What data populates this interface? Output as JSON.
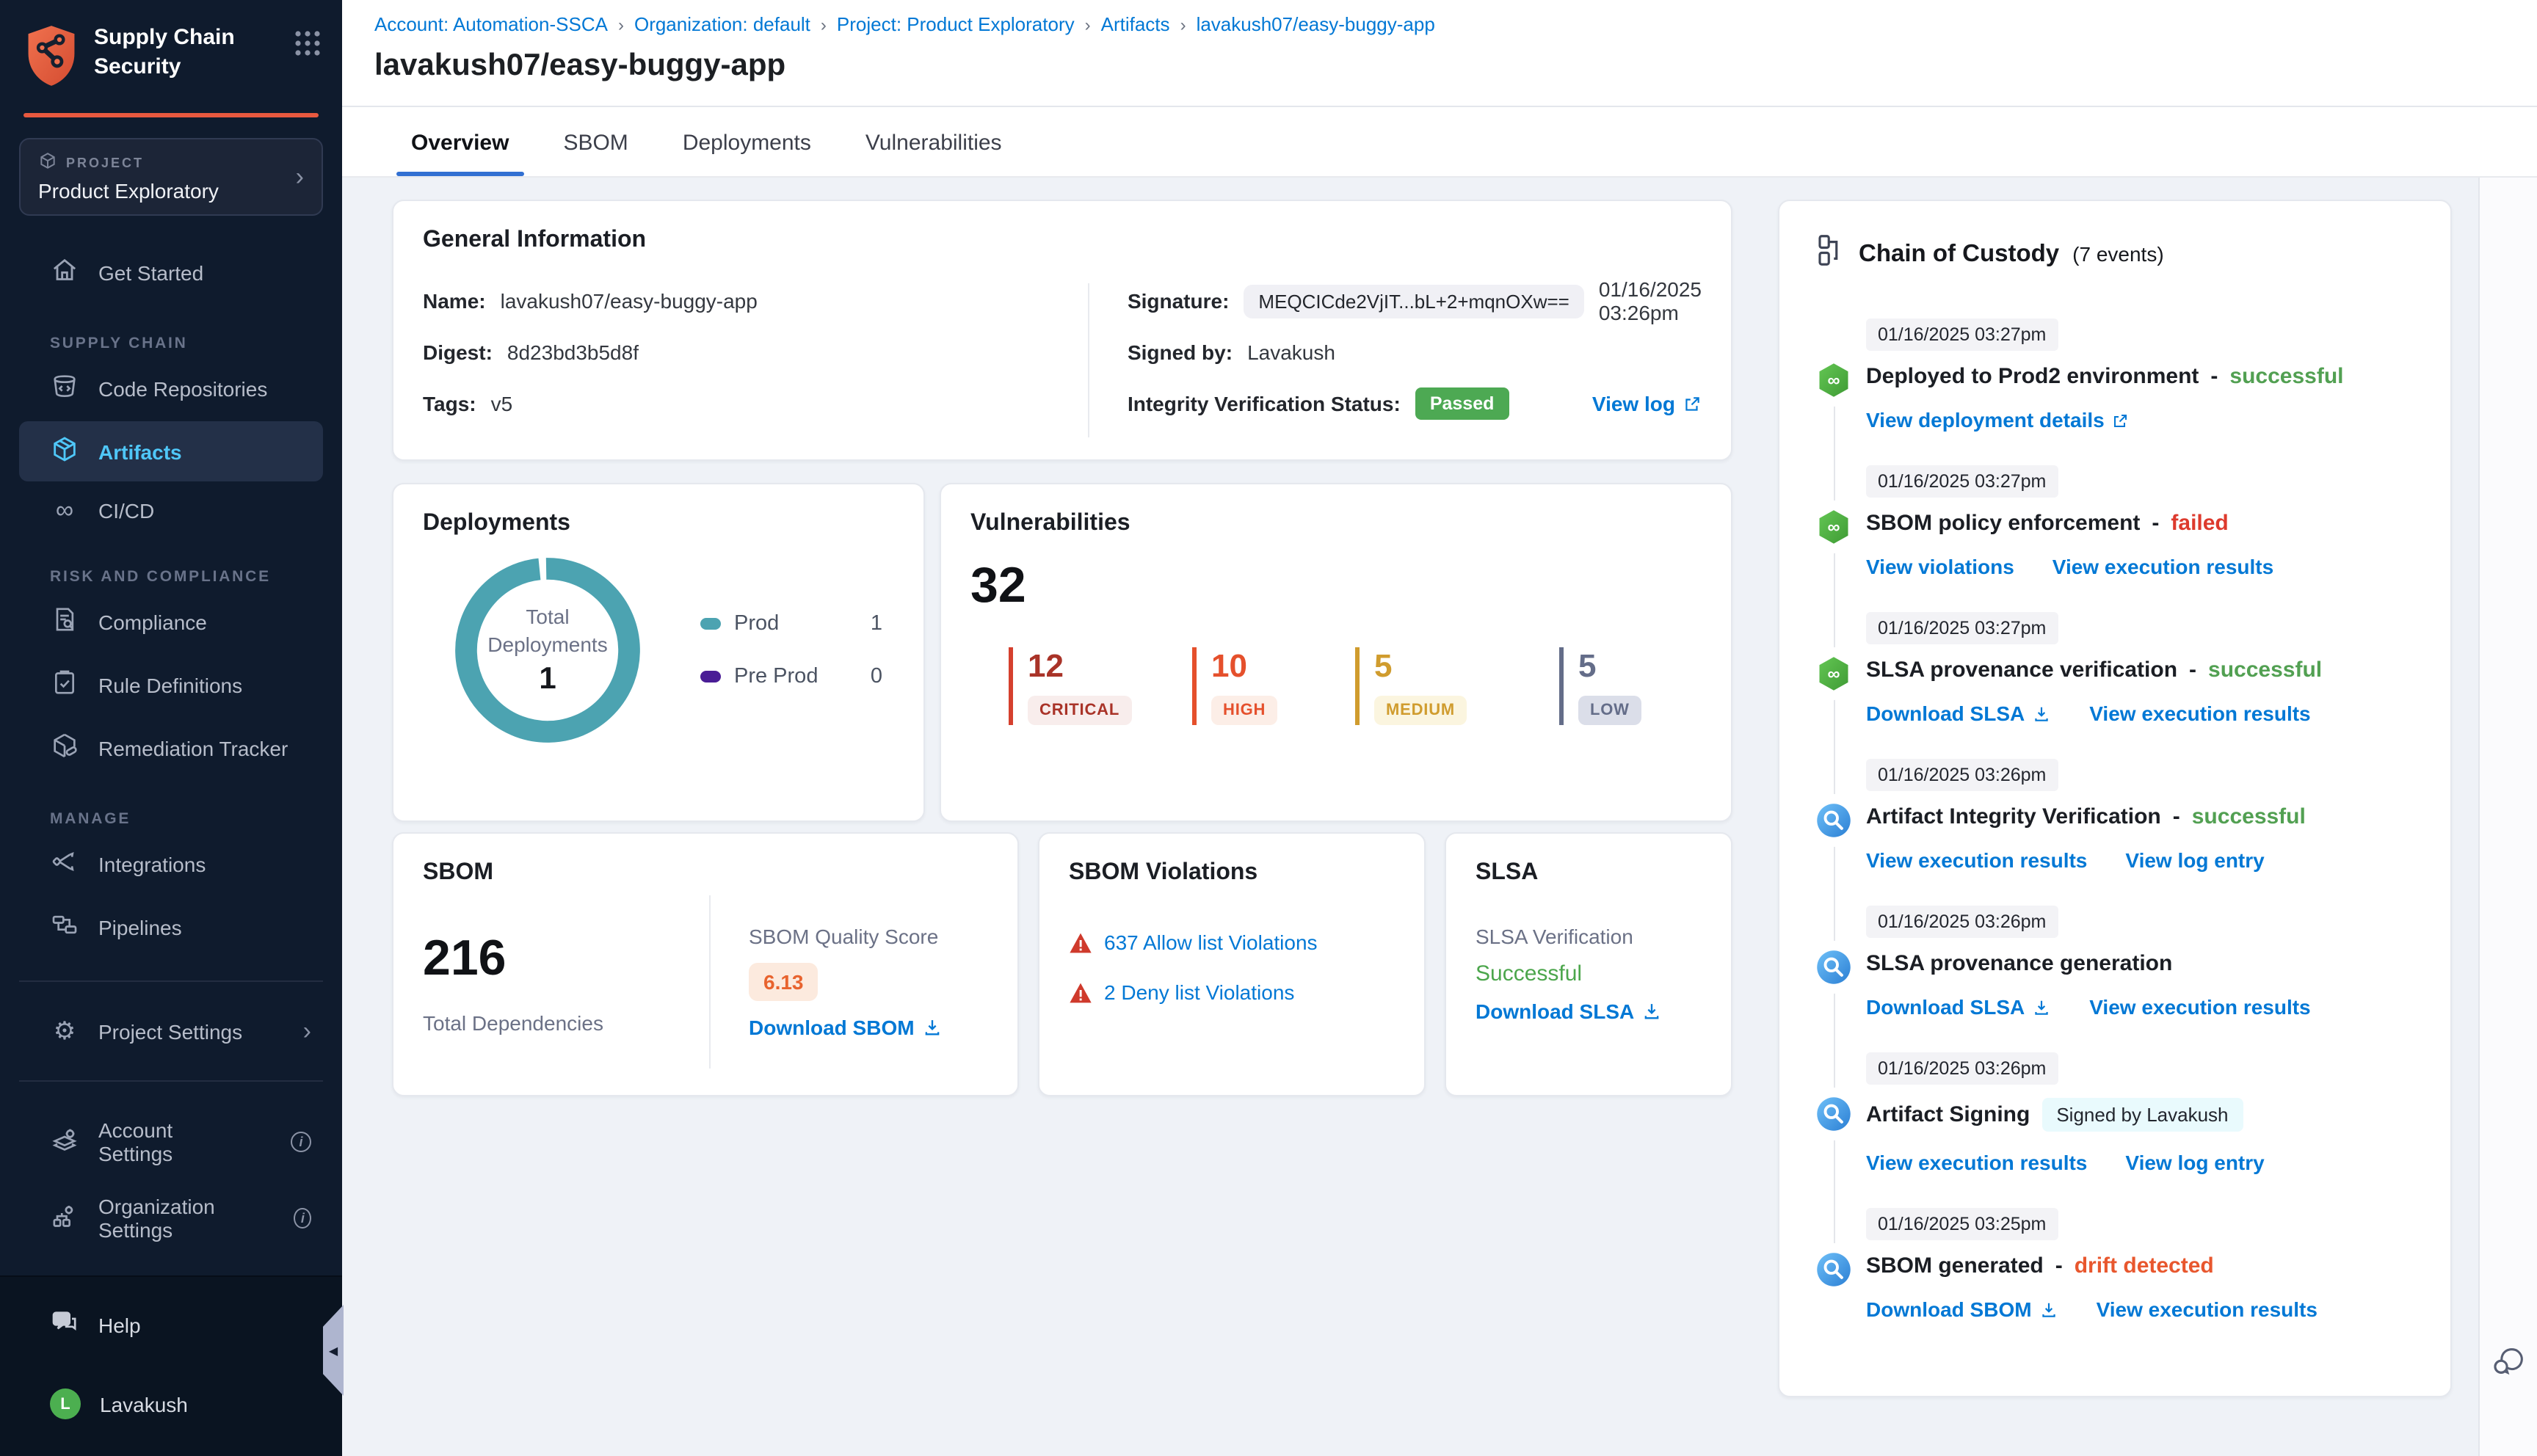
{
  "sidebar": {
    "app_title_line1": "Supply Chain",
    "app_title_line2": "Security",
    "project": {
      "label": "PROJECT",
      "name": "Product Exploratory"
    },
    "sections": {
      "supply_chain": "SUPPLY CHAIN",
      "risk": "RISK AND COMPLIANCE",
      "manage": "MANAGE"
    },
    "nav": [
      {
        "label": "Get Started"
      },
      {
        "label": "Code Repositories"
      },
      {
        "label": "Artifacts"
      },
      {
        "label": "CI/CD"
      },
      {
        "label": "Compliance"
      },
      {
        "label": "Rule Definitions"
      },
      {
        "label": "Remediation Tracker"
      },
      {
        "label": "Integrations"
      },
      {
        "label": "Pipelines"
      },
      {
        "label": "Project Settings"
      },
      {
        "label": "Account Settings"
      },
      {
        "label": "Organization Settings"
      }
    ],
    "help": "Help",
    "user": "Lavakush",
    "avatar_initial": "L"
  },
  "breadcrumb": {
    "separator": "›",
    "items": [
      "Account: Automation-SSCA",
      "Organization: default",
      "Project: Product Exploratory",
      "Artifacts",
      "lavakush07/easy-buggy-app"
    ]
  },
  "page": {
    "title": "lavakush07/easy-buggy-app"
  },
  "tabs": [
    "Overview",
    "SBOM",
    "Deployments",
    "Vulnerabilities"
  ],
  "general_info": {
    "title": "General Information",
    "name_label": "Name:",
    "name_value": "lavakush07/easy-buggy-app",
    "digest_label": "Digest:",
    "digest_value": "8d23bd3b5d8f",
    "tags_label": "Tags:",
    "tags_value": "v5",
    "signature_label": "Signature:",
    "signature_value": "MEQCICde2VjIT...bL+2+mqnOXw==",
    "signature_date": "01/16/2025 03:26pm",
    "signed_by_label": "Signed by:",
    "signed_by_value": "Lavakush",
    "integrity_label": "Integrity Verification Status:",
    "integrity_status": "Passed",
    "view_log": "View log"
  },
  "deployments": {
    "title": "Deployments",
    "center_label": "Total Deployments",
    "total": "1",
    "legend": [
      {
        "label": "Prod",
        "value": "1",
        "color": "#4ca3b1"
      },
      {
        "label": "Pre Prod",
        "value": "0",
        "color": "#4a1d96"
      }
    ]
  },
  "vulnerabilities": {
    "title": "Vulnerabilities",
    "total": "32",
    "severities": [
      {
        "count": "12",
        "label": "CRITICAL",
        "color": "#a93328",
        "bar": "#d5402e",
        "bg": "#f8edec"
      },
      {
        "count": "10",
        "label": "HIGH",
        "color": "#e5502c",
        "bar": "#e5502c",
        "bg": "#fceee7"
      },
      {
        "count": "5",
        "label": "MEDIUM",
        "color": "#d09c2e",
        "bar": "#d09c2e",
        "bg": "#fbf5df"
      },
      {
        "count": "5",
        "label": "LOW",
        "color": "#646d89",
        "bar": "#646d89",
        "bg": "#dbdee9"
      }
    ]
  },
  "sbom": {
    "title": "SBOM",
    "total": "216",
    "total_label": "Total Dependencies",
    "score_label": "SBOM Quality Score",
    "score": "6.13",
    "download": "Download SBOM"
  },
  "sbom_violations": {
    "title": "SBOM Violations",
    "allow": "637 Allow list Violations",
    "deny": "2 Deny list Violations"
  },
  "slsa": {
    "title": "SLSA",
    "verification_label": "SLSA Verification",
    "verification_status": "Successful",
    "download": "Download SLSA"
  },
  "custody": {
    "title": "Chain of Custody",
    "count": "(7 events)",
    "events": [
      {
        "timestamp": "01/16/2025 03:27pm",
        "title": "Deployed to Prod2 environment",
        "sep": "-",
        "status": "successful",
        "links": [
          {
            "label": "View deployment details"
          }
        ]
      },
      {
        "timestamp": "01/16/2025 03:27pm",
        "title": "SBOM policy enforcement",
        "sep": "-",
        "status": "failed",
        "links": [
          {
            "label": "View violations"
          },
          {
            "label": "View execution results"
          }
        ]
      },
      {
        "timestamp": "01/16/2025 03:27pm",
        "title": "SLSA provenance verification",
        "sep": "-",
        "status": "successful",
        "links": [
          {
            "label": "Download SLSA"
          },
          {
            "label": "View execution results"
          }
        ]
      },
      {
        "timestamp": "01/16/2025 03:26pm",
        "title": "Artifact Integrity Verification",
        "sep": "-",
        "status": "successful",
        "links": [
          {
            "label": "View execution results"
          },
          {
            "label": "View log entry"
          }
        ]
      },
      {
        "timestamp": "01/16/2025 03:26pm",
        "title": "SLSA provenance generation",
        "sep": "",
        "status": "",
        "links": [
          {
            "label": "Download SLSA"
          },
          {
            "label": "View execution results"
          }
        ]
      },
      {
        "timestamp": "01/16/2025 03:26pm",
        "title": "Artifact Signing",
        "sep": "",
        "status": "",
        "badge": "Signed by Lavakush",
        "links": [
          {
            "label": "View execution results"
          },
          {
            "label": "View log entry"
          }
        ]
      },
      {
        "timestamp": "01/16/2025 03:25pm",
        "title": "SBOM generated",
        "sep": "-",
        "status": "drift detected",
        "links": [
          {
            "label": "Download SBOM"
          },
          {
            "label": "View execution results"
          }
        ]
      }
    ]
  },
  "chart_data": [
    {
      "type": "pie",
      "title": "Deployments",
      "categories": [
        "Prod",
        "Pre Prod"
      ],
      "values": [
        1,
        0
      ],
      "center_total": 1,
      "colors": [
        "#4ca3b1",
        "#4a1d96"
      ],
      "legend_position": "right"
    },
    {
      "type": "bar",
      "title": "Vulnerabilities",
      "categories": [
        "CRITICAL",
        "HIGH",
        "MEDIUM",
        "LOW"
      ],
      "values": [
        12,
        10,
        5,
        5
      ],
      "total": 32
    }
  ]
}
